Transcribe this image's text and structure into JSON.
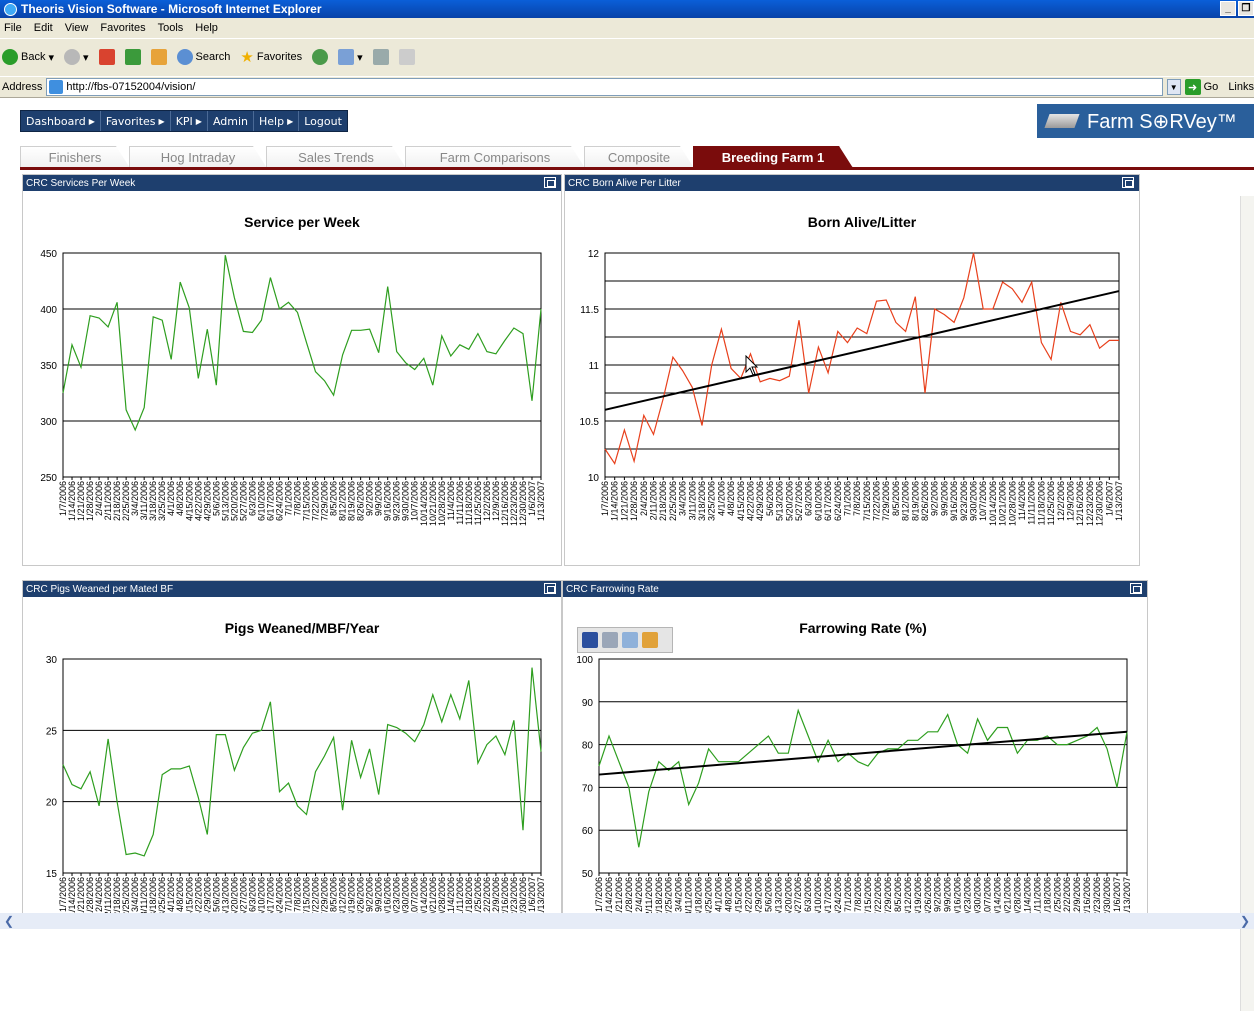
{
  "browser": {
    "title": "Theoris Vision Software - Microsoft Internet Explorer",
    "menu": [
      "File",
      "Edit",
      "View",
      "Favorites",
      "Tools",
      "Help"
    ],
    "toolbar": {
      "back": "Back",
      "search": "Search",
      "favorites": "Favorites"
    },
    "address_label": "Address",
    "url": "http://fbs-07152004/vision/",
    "go_label": "Go",
    "links_label": "Links"
  },
  "nav": {
    "items": [
      {
        "label": "Dashboard"
      },
      {
        "label": "Favorites"
      },
      {
        "label": "KPI"
      },
      {
        "label": "Admin"
      },
      {
        "label": "Help"
      },
      {
        "label": "Logout"
      }
    ]
  },
  "logo": {
    "text": "Farm S⊕RVey™"
  },
  "tabs": [
    "Finishers",
    "Hog Intraday",
    "Sales Trends",
    "Farm Comparisons",
    "Composite",
    "Breeding Farm 1"
  ],
  "panels": {
    "p1_header": "CRC Services Per Week",
    "p2_header": "CRC Born Alive Per Litter",
    "p3_header": "CRC Pigs Weaned per Mated BF",
    "p4_header": "CRC Farrowing Rate"
  },
  "colors": {
    "nav_bg": "#1e3f6e",
    "active_tab": "#7a0c0c",
    "green_series": "#2e9e1f",
    "red_series": "#e8401c"
  },
  "chart_data": [
    {
      "type": "line",
      "title": "Service per Week",
      "ylim": [
        250,
        450
      ],
      "yticks": [
        250,
        300,
        350,
        400,
        450
      ],
      "x": [
        "1/7/2006",
        "1/14/2006",
        "1/21/2006",
        "1/28/2006",
        "2/4/2006",
        "2/11/2006",
        "2/18/2006",
        "2/25/2006",
        "3/4/2006",
        "3/11/2006",
        "3/18/2006",
        "3/25/2006",
        "4/1/2006",
        "4/8/2006",
        "4/15/2006",
        "4/22/2006",
        "4/29/2006",
        "5/6/2006",
        "5/13/2006",
        "5/20/2006",
        "5/27/2006",
        "6/3/2006",
        "6/10/2006",
        "6/17/2006",
        "6/24/2006",
        "7/1/2006",
        "7/8/2006",
        "7/15/2006",
        "7/22/2006",
        "7/29/2006",
        "8/5/2006",
        "8/12/2006",
        "8/19/2006",
        "8/26/2006",
        "9/2/2006",
        "9/9/2006",
        "9/16/2006",
        "9/23/2006",
        "9/30/2006",
        "10/7/2006",
        "10/14/2006",
        "10/21/2006",
        "10/28/2006",
        "11/4/2006",
        "11/11/2006",
        "11/18/2006",
        "11/25/2006",
        "12/2/2006",
        "12/9/2006",
        "12/16/2006",
        "12/23/2006",
        "12/30/2006",
        "1/6/2007",
        "1/13/2007"
      ],
      "series": [
        {
          "values": [
            325,
            368,
            348,
            394,
            392,
            384,
            406,
            310,
            292,
            312,
            393,
            390,
            355,
            424,
            401,
            338,
            382,
            332,
            448,
            410,
            380,
            379,
            390,
            428,
            400,
            406,
            397,
            370,
            344,
            336,
            323,
            359,
            381,
            381,
            382,
            361,
            420,
            362,
            352,
            346,
            356,
            332,
            376,
            358,
            368,
            364,
            378,
            362,
            360,
            372,
            383,
            378,
            318,
            400
          ]
        }
      ]
    },
    {
      "type": "line",
      "title": "Born Alive/Litter",
      "ylim": [
        10,
        12
      ],
      "yticks": [
        10,
        10.5,
        11,
        11.5,
        12
      ],
      "x": [
        "1/7/2006",
        "1/14/2006",
        "1/21/2006",
        "1/28/2006",
        "2/4/2006",
        "2/11/2006",
        "2/18/2006",
        "2/25/2006",
        "3/4/2006",
        "3/11/2006",
        "3/18/2006",
        "3/25/2006",
        "4/1/2006",
        "4/8/2006",
        "4/15/2006",
        "4/22/2006",
        "4/29/2006",
        "5/6/2006",
        "5/13/2006",
        "5/20/2006",
        "5/27/2006",
        "6/3/2006",
        "6/10/2006",
        "6/17/2006",
        "6/24/2006",
        "7/1/2006",
        "7/8/2006",
        "7/15/2006",
        "7/22/2006",
        "7/29/2006",
        "8/5/2006",
        "8/12/2006",
        "8/19/2006",
        "8/26/2006",
        "9/2/2006",
        "9/9/2006",
        "9/16/2006",
        "9/23/2006",
        "9/30/2006",
        "10/7/2006",
        "10/14/2006",
        "10/21/2006",
        "10/28/2006",
        "11/4/2006",
        "11/11/2006",
        "11/18/2006",
        "11/25/2006",
        "12/2/2006",
        "12/9/2006",
        "12/16/2006",
        "12/23/2006",
        "12/30/2006",
        "1/6/2007",
        "1/13/2007"
      ],
      "series": [
        {
          "values": [
            10.25,
            10.12,
            10.42,
            10.14,
            10.55,
            10.38,
            10.7,
            11.07,
            10.95,
            10.8,
            10.46,
            11.0,
            11.32,
            10.97,
            10.88,
            11.1,
            10.85,
            10.88,
            10.86,
            10.9,
            11.4,
            10.75,
            11.16,
            10.93,
            11.3,
            11.2,
            11.33,
            11.28,
            11.57,
            11.58,
            11.38,
            11.3,
            11.61,
            10.75,
            11.5,
            11.45,
            11.38,
            11.6,
            12.0,
            11.5,
            11.5,
            11.74,
            11.68,
            11.56,
            11.74,
            11.2,
            11.05,
            11.56,
            11.3,
            11.27,
            11.36,
            11.15,
            11.22,
            11.22
          ]
        }
      ],
      "trend": [
        10.6,
        11.66
      ]
    },
    {
      "type": "line",
      "title": "Pigs Weaned/MBF/Year",
      "ylim": [
        15,
        30
      ],
      "yticks": [
        15,
        20,
        25,
        30
      ],
      "x": [
        "1/7/2006",
        "1/14/2006",
        "1/21/2006",
        "1/28/2006",
        "2/4/2006",
        "2/11/2006",
        "2/18/2006",
        "2/25/2006",
        "3/4/2006",
        "3/11/2006",
        "3/18/2006",
        "3/25/2006",
        "4/1/2006",
        "4/8/2006",
        "4/15/2006",
        "4/22/2006",
        "4/29/2006",
        "5/6/2006",
        "5/13/2006",
        "5/20/2006",
        "5/27/2006",
        "6/3/2006",
        "6/10/2006",
        "6/17/2006",
        "6/24/2006",
        "7/1/2006",
        "7/8/2006",
        "7/15/2006",
        "7/22/2006",
        "7/29/2006",
        "8/5/2006",
        "8/12/2006",
        "8/19/2006",
        "8/26/2006",
        "9/2/2006",
        "9/9/2006",
        "9/16/2006",
        "9/23/2006",
        "9/30/2006",
        "10/7/2006",
        "10/14/2006",
        "10/21/2006",
        "10/28/2006",
        "11/4/2006",
        "11/11/2006",
        "11/18/2006",
        "11/25/2006",
        "12/2/2006",
        "12/9/2006",
        "12/16/2006",
        "12/23/2006",
        "12/30/2006",
        "1/6/2007",
        "1/13/2007"
      ],
      "series": [
        {
          "values": [
            22.6,
            21.2,
            20.9,
            22.1,
            19.7,
            24.4,
            20.0,
            16.3,
            16.4,
            16.2,
            17.7,
            21.9,
            22.3,
            22.3,
            22.5,
            20.3,
            17.7,
            24.7,
            24.7,
            22.2,
            23.8,
            24.8,
            25.0,
            27.0,
            20.7,
            21.3,
            19.7,
            19.1,
            22.1,
            23.2,
            24.5,
            19.4,
            24.3,
            21.7,
            23.7,
            20.5,
            25.4,
            25.2,
            24.8,
            24.2,
            25.4,
            27.5,
            25.6,
            27.5,
            25.8,
            28.5,
            22.7,
            24.0,
            24.6,
            23.3,
            25.7,
            18.0,
            29.4,
            23.5
          ]
        }
      ]
    },
    {
      "type": "line",
      "title": "Farrowing Rate (%)",
      "ylim": [
        50,
        100
      ],
      "yticks": [
        50,
        60,
        70,
        80,
        90,
        100
      ],
      "x": [
        "1/7/2006",
        "1/14/2006",
        "1/21/2006",
        "1/28/2006",
        "2/4/2006",
        "2/11/2006",
        "2/18/2006",
        "2/25/2006",
        "3/4/2006",
        "3/11/2006",
        "3/18/2006",
        "3/25/2006",
        "4/1/2006",
        "4/8/2006",
        "4/15/2006",
        "4/22/2006",
        "4/29/2006",
        "5/6/2006",
        "5/13/2006",
        "5/20/2006",
        "5/27/2006",
        "6/3/2006",
        "6/10/2006",
        "6/17/2006",
        "6/24/2006",
        "7/1/2006",
        "7/8/2006",
        "7/15/2006",
        "7/22/2006",
        "7/29/2006",
        "8/5/2006",
        "8/12/2006",
        "8/19/2006",
        "8/26/2006",
        "9/2/2006",
        "9/9/2006",
        "9/16/2006",
        "9/23/2006",
        "9/30/2006",
        "10/7/2006",
        "10/14/2006",
        "10/21/2006",
        "10/28/2006",
        "11/4/2006",
        "11/11/2006",
        "11/18/2006",
        "11/25/2006",
        "12/2/2006",
        "12/9/2006",
        "12/16/2006",
        "12/23/2006",
        "12/30/2006",
        "1/6/2007",
        "1/13/2007"
      ],
      "series": [
        {
          "values": [
            75,
            82,
            76,
            70,
            56,
            69,
            76,
            74,
            76,
            66,
            71,
            79,
            76,
            76,
            76,
            78,
            80,
            82,
            78,
            78,
            88,
            82,
            76,
            81,
            76,
            78,
            76,
            75,
            78,
            79,
            79,
            81,
            81,
            83,
            83,
            87,
            80,
            78,
            86,
            81,
            84,
            84,
            78,
            81,
            81,
            82,
            80,
            80,
            81,
            82,
            84,
            79,
            70,
            83
          ]
        }
      ],
      "trend": [
        73,
        83
      ]
    }
  ]
}
